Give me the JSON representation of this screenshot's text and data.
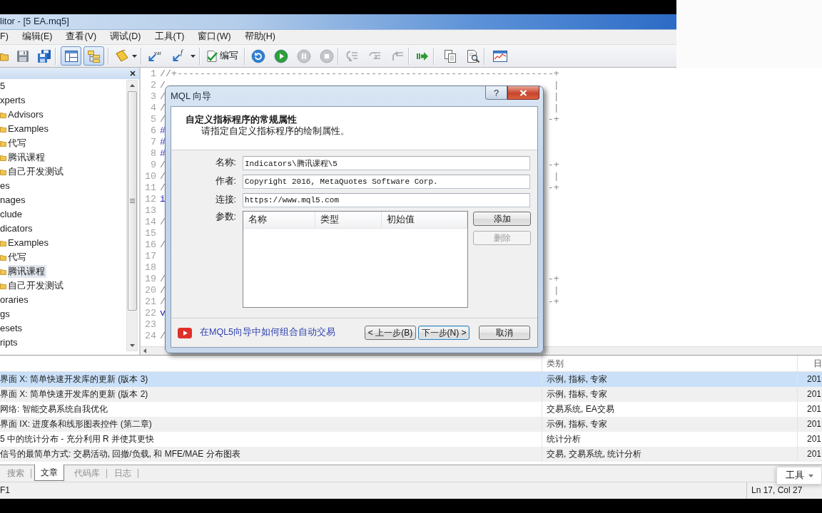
{
  "window": {
    "title": "litor - [5 EA.mq5]"
  },
  "menu": [
    "F)",
    "编辑(E)",
    "查看(V)",
    "调试(D)",
    "工具(T)",
    "窗口(W)",
    "帮助(H)"
  ],
  "toolbar": {
    "layout_toggles": [
      {
        "pressed": true
      },
      {
        "pressed": true
      }
    ],
    "insert_buttons": [
      {
        "glyph": "var"
      },
      {
        "glyph": "f"
      }
    ],
    "compile_label": "编写",
    "run_controls": [
      {
        "disabled": false
      },
      {
        "disabled": false
      },
      {
        "disabled": true
      },
      {
        "disabled": true
      }
    ],
    "step_controls": [
      {
        "disabled": true
      },
      {
        "disabled": true
      },
      {
        "disabled": true
      }
    ]
  },
  "navigator": {
    "items": [
      {
        "label": "5",
        "selected": false,
        "children": [
          {
            "label": "xperts",
            "selected": false,
            "children": [
              {
                "label": "Advisors",
                "selected": false
              },
              {
                "label": "Examples",
                "selected": false
              },
              {
                "label": "代写",
                "selected": false
              },
              {
                "label": "腾讯课程",
                "selected": false
              },
              {
                "label": "自己开发测试",
                "selected": false
              }
            ]
          },
          {
            "label": "es",
            "selected": false
          },
          {
            "label": "nages",
            "selected": false
          },
          {
            "label": "clude",
            "selected": false
          },
          {
            "label": "dicators",
            "selected": false,
            "children": [
              {
                "label": "Examples",
                "selected": false
              },
              {
                "label": "代写",
                "selected": false
              },
              {
                "label": "腾讯课程",
                "selected": true
              },
              {
                "label": "自己开发测试",
                "selected": false
              }
            ]
          },
          {
            "label": "oraries",
            "selected": false
          },
          {
            "label": "gs",
            "selected": false
          },
          {
            "label": "esets",
            "selected": false
          },
          {
            "label": "ripts",
            "selected": false
          }
        ]
      }
    ]
  },
  "editor": {
    "lines": [
      {
        "number": "1",
        "kind": "comment",
        "left": "//+------------------------------------------------------------------+"
      },
      {
        "number": "2",
        "kind": "comment",
        "left": "/",
        "right": "|"
      },
      {
        "number": "3",
        "kind": "comment",
        "left": "/",
        "right": "|"
      },
      {
        "number": "4",
        "kind": "comment",
        "left": "/",
        "right": "|"
      },
      {
        "number": "5",
        "kind": "comment",
        "left": "/",
        "right": "-+"
      },
      {
        "number": "6",
        "kind": "directive",
        "left": "#"
      },
      {
        "number": "7",
        "kind": "directive",
        "left": "#"
      },
      {
        "number": "8",
        "kind": "directive",
        "left": "#"
      },
      {
        "number": "9",
        "kind": "comment",
        "left": "/",
        "right": "-+"
      },
      {
        "number": "10",
        "kind": "comment",
        "left": "/",
        "right": "|"
      },
      {
        "number": "11",
        "kind": "comment",
        "left": "/",
        "right": "-+"
      },
      {
        "number": "12",
        "kind": "keyword",
        "left": "i"
      },
      {
        "number": "13"
      },
      {
        "number": "14",
        "kind": "comment",
        "left": "/"
      },
      {
        "number": "15"
      },
      {
        "number": "16",
        "kind": "comment",
        "left": "/"
      },
      {
        "number": "17"
      },
      {
        "number": "18"
      },
      {
        "number": "19",
        "kind": "comment",
        "left": "/",
        "right": "-+"
      },
      {
        "number": "20",
        "kind": "comment",
        "left": "/",
        "right": "|"
      },
      {
        "number": "21",
        "kind": "comment",
        "left": "/",
        "right": "-+"
      },
      {
        "number": "22",
        "kind": "keyword",
        "left": "v"
      },
      {
        "number": "23"
      },
      {
        "number": "24",
        "kind": "comment",
        "left": "/"
      }
    ]
  },
  "dialog": {
    "title": "MQL 向导",
    "help_button": "?",
    "heading": "自定义指标程序的常规属性",
    "subheading": "请指定自定义指标程序的绘制属性。",
    "fields": [
      {
        "label": "名称:",
        "value": "Indicators\\腾讯课程\\5"
      },
      {
        "label": "作者:",
        "value": "Copyright 2016, MetaQuotes Software Corp."
      },
      {
        "label": "连接:",
        "value": "https://www.mql5.com"
      }
    ],
    "parameters": {
      "label": "参数:",
      "columns": [
        "名称",
        "类型",
        "初始值"
      ]
    },
    "side_buttons": [
      {
        "label": "添加",
        "disabled": false
      },
      {
        "label": "删除",
        "disabled": true
      }
    ],
    "help_link": "在MQL5向导中如何组合自动交易",
    "buttons": [
      {
        "label": "< 上一步(B)",
        "focused": false
      },
      {
        "label": "下一步(N) >",
        "focused": true
      },
      {
        "label": "取消",
        "focused": false
      }
    ]
  },
  "toolbox": {
    "headers": {
      "column_2": "类别",
      "column_3": "日"
    },
    "rows": [
      {
        "selected": true,
        "cells": [
          "界面 X: 简单快速开发库的更新 (版本 3)",
          "示例, 指标, 专家",
          "201"
        ]
      },
      {
        "selected": false,
        "cells": [
          "界面 X: 简单快速开发库的更新 (版本 2)",
          "示例, 指标, 专家",
          "201"
        ]
      },
      {
        "selected": false,
        "cells": [
          "网络: 智能交易系统自我优化",
          "交易系统, EA交易",
          "201"
        ]
      },
      {
        "selected": false,
        "cells": [
          "界面 IX: 进度条和线形图表控件 (第二章)",
          "示例, 指标, 专家",
          "201"
        ]
      },
      {
        "selected": false,
        "cells": [
          "5 中的统计分布 - 充分利用 R 并使其更快",
          "统计分析",
          "201"
        ]
      },
      {
        "selected": false,
        "cells": [
          "信号的最简单方式: 交易活动, 回撤/负载, 和 MFE/MAE 分布图表",
          "交易, 交易系统, 统计分析",
          "201"
        ]
      }
    ],
    "tabs": [
      {
        "label": "搜索",
        "selected": false
      },
      {
        "label": "文章",
        "selected": true
      },
      {
        "label": "代码库",
        "selected": false
      },
      {
        "label": "日志",
        "selected": false
      }
    ],
    "tools_button": "工具"
  },
  "status_bar": {
    "hint": "F1",
    "position": "Ln 17, Col 27"
  }
}
